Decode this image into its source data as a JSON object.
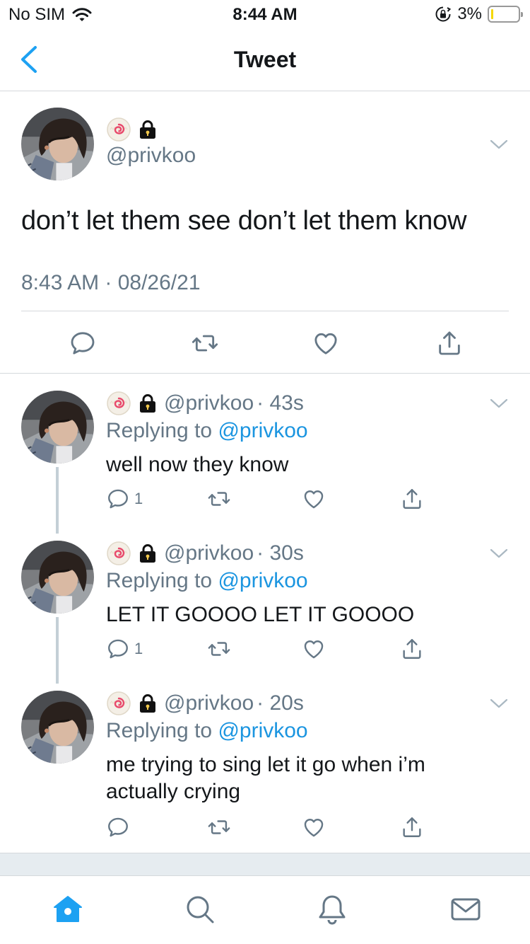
{
  "status_bar": {
    "carrier": "No SIM",
    "time": "8:44 AM",
    "battery": "3%",
    "battery_level": 0.03
  },
  "header": {
    "title": "Tweet"
  },
  "main_tweet": {
    "handle": "@privkoo",
    "text": "don’t let them see don’t let them know",
    "timestamp": "8:43 AM · 08/26/21"
  },
  "replies": [
    {
      "handle": "@privkoo",
      "age": "· 43s",
      "replying_prefix": "Replying to ",
      "replying_to": "@privkoo",
      "text": "well now they know",
      "reply_count": "1"
    },
    {
      "handle": "@privkoo",
      "age": "· 30s",
      "replying_prefix": "Replying to ",
      "replying_to": "@privkoo",
      "text": "LET IT GOOOO LET IT GOOOO",
      "reply_count": "1"
    },
    {
      "handle": "@privkoo",
      "age": "· 20s",
      "replying_prefix": "Replying to ",
      "replying_to": "@privkoo",
      "text": "me trying to sing let it go when i’m actually crying",
      "reply_count": ""
    }
  ],
  "icons": {
    "back": "chevron-left-icon",
    "reply": "reply-icon",
    "retweet": "retweet-icon",
    "like": "heart-icon",
    "share": "share-icon",
    "more": "chevron-down-icon",
    "badge": "narutomaki-emoji-icon",
    "lock": "lock-icon",
    "tabs": [
      "home-icon",
      "search-icon",
      "bell-icon",
      "mail-icon"
    ]
  },
  "colors": {
    "accent": "#1da1f2",
    "link": "#1b95e0",
    "secondary_text": "#657786",
    "divider": "#d5d9dc"
  }
}
